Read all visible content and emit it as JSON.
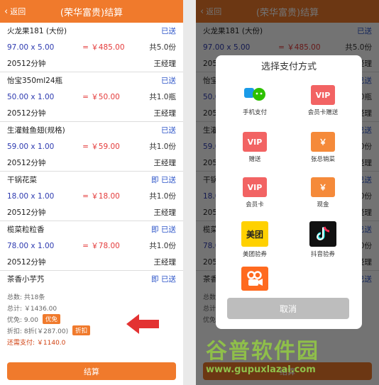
{
  "header": {
    "back_label": "返回",
    "title": "(荣华富贵)结算"
  },
  "items": [
    {
      "name": "火龙果181 (大份)",
      "status": "已送",
      "qty": "97.00 x 5.00",
      "total": "= ￥485.00",
      "count": "共5.0份",
      "duration": "20512分钟",
      "manager": "王经理"
    },
    {
      "name": "怡宝350ml24瓶",
      "status": "已送",
      "qty": "50.00 x 1.00",
      "total": "= ￥50.00",
      "count": "共1.0瓶",
      "duration": "20512分钟",
      "manager": "王经理"
    },
    {
      "name": "生灌鲑鱼翅(规格)",
      "status": "已送",
      "qty": "59.00 x 1.00",
      "total": "= ￥59.00",
      "count": "共1.0份",
      "duration": "20512分钟",
      "manager": "王经理"
    },
    {
      "name": "干锅花菜",
      "status": "即 已送",
      "qty": "18.00 x 1.00",
      "total": "= ￥18.00",
      "count": "共1.0份",
      "duration": "20512分钟",
      "manager": "王经理"
    },
    {
      "name": "榄菜粒粒香",
      "status": "即 已送",
      "qty": "78.00 x 1.00",
      "total": "= ￥78.00",
      "count": "共1.0份",
      "duration": "20512分钟",
      "manager": "王经理"
    },
    {
      "name": "茶香小芋艿",
      "status": "即 已送",
      "qty": "",
      "total": "",
      "count": "",
      "duration": "",
      "manager": ""
    }
  ],
  "summary": {
    "total_count": "总数: 共18条",
    "subtotal": "总计: ￥1436.00",
    "discount": "优免: 9.00",
    "discount_tag": "优免",
    "rebate": "折扣: 8折(￥287.00)",
    "rebate_tag": "折扣",
    "payable": "还需支付: ￥1140.0"
  },
  "checkout_label": "结算",
  "dialog": {
    "title": "选择支付方式",
    "cancel_label": "取消",
    "methods": [
      {
        "label": "手机支付",
        "icon": "mobile-pay-icon",
        "glyph": ""
      },
      {
        "label": "会员卡赠送",
        "icon": "vip-icon",
        "glyph": "VIP"
      },
      {
        "label": "赠送",
        "icon": "vip-icon",
        "glyph": "VIP"
      },
      {
        "label": "张总销菜",
        "icon": "yen-icon",
        "glyph": "￥"
      },
      {
        "label": "会员卡",
        "icon": "vip-icon",
        "glyph": "VIP"
      },
      {
        "label": "现金",
        "icon": "yen-icon",
        "glyph": "￥"
      },
      {
        "label": "美团验券",
        "icon": "meituan-icon",
        "glyph": "美团"
      },
      {
        "label": "抖音验券",
        "icon": "douyin-icon",
        "glyph": ""
      },
      {
        "label": "",
        "icon": "kuaishou-icon",
        "glyph": ""
      }
    ]
  },
  "watermark": {
    "text": "谷普软件园",
    "url": "www.gupuxlazal.com"
  }
}
